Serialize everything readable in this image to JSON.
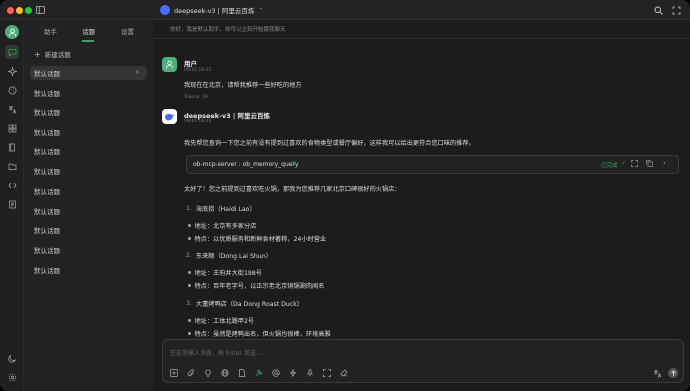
{
  "window": {
    "title": "deepseek-v3 | 阿里云百炼",
    "chevron": "⌃",
    "traffic_colors": [
      "#ff5f57",
      "#febc2e",
      "#28c840"
    ]
  },
  "sidebar": {
    "tabs": [
      "助手",
      "话题",
      "设置"
    ],
    "active_tab": 1,
    "new_topic_label": "新建话题",
    "topics": [
      "默认话题",
      "默认话题",
      "默认话题",
      "默认话题",
      "默认话题",
      "默认话题",
      "默认话题",
      "默认话题",
      "默认话题",
      "默认话题",
      "默认话题"
    ]
  },
  "chat": {
    "system_prompt": "你好，我是默认助手。你可以立刻开始跟我聊天",
    "user": {
      "name": "用户",
      "time": "09/16 16:22",
      "message": "我现在在北京，请帮我推荐一些好吃的地方",
      "tokens": "Tokens: 19"
    },
    "assistant": {
      "name": "deepseek-v3 | 阿里云百炼",
      "time": "09/16 16:22",
      "intro": "我先帮您查询一下您之前有没有提到过喜欢的食物类型或餐厅偏好，这样我可以给出更符合您口味的推荐。",
      "tool": {
        "name": "ob-mcp-server : ob_memory_query",
        "status": "已完成"
      },
      "reply": "太好了！您之前提到过喜欢吃火锅，那我为您推荐几家北京口碑很好的火锅店：",
      "restaurants": [
        {
          "num": "1.",
          "title": "海底捞（Haidi Lao）",
          "items": [
            "地址：北京有多家分店",
            "特点：以优质服务和新鲜食材著称，24小时营业"
          ]
        },
        {
          "num": "2.",
          "title": "东来顺（Dong Lai Shun）",
          "items": [
            "地址：王府井大街198号",
            "特点：百年老字号，以正宗老北京铜锅涮肉闻名"
          ]
        },
        {
          "num": "3.",
          "title": "大董烤鸭店（Da Dong Roast Duck）",
          "items": [
            "地址：工体北路甲2号",
            "特点：虽然是烤鸭出名，但火锅也很棒，环境高雅"
          ]
        }
      ]
    }
  },
  "input": {
    "placeholder": "在这里输入消息，按 Enter 发送..."
  },
  "colors": {
    "accent": "#3fa06a",
    "user_avatar": "#4caf7d",
    "deepseek": "#4d6bfe"
  }
}
